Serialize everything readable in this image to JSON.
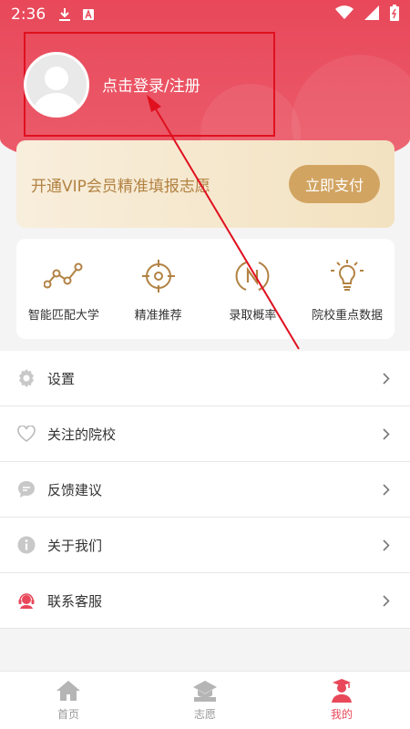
{
  "status_bar": {
    "time": "2:36"
  },
  "profile": {
    "login_text": "点击登录/注册"
  },
  "vip": {
    "text": "开通VIP会员精准填报志愿",
    "button_label": "立即支付"
  },
  "features": [
    {
      "label": "智能匹配大学",
      "icon": "graph-icon"
    },
    {
      "label": "精准推荐",
      "icon": "target-icon"
    },
    {
      "label": "录取概率",
      "icon": "probability-icon"
    },
    {
      "label": "院校重点数据",
      "icon": "lightbulb-icon"
    }
  ],
  "menu": [
    {
      "label": "设置",
      "icon": "gear-icon"
    },
    {
      "label": "关注的院校",
      "icon": "heart-icon"
    },
    {
      "label": "反馈建议",
      "icon": "chat-icon"
    },
    {
      "label": "关于我们",
      "icon": "info-icon"
    },
    {
      "label": "联系客服",
      "icon": "headset-icon"
    }
  ],
  "bottom_nav": [
    {
      "label": "首页",
      "icon": "home-icon"
    },
    {
      "label": "志愿",
      "icon": "graduation-icon"
    },
    {
      "label": "我的",
      "icon": "user-icon",
      "active": true
    }
  ],
  "colors": {
    "brand": "#e8485a",
    "gold": "#d2a462",
    "gold_text": "#b28243"
  }
}
